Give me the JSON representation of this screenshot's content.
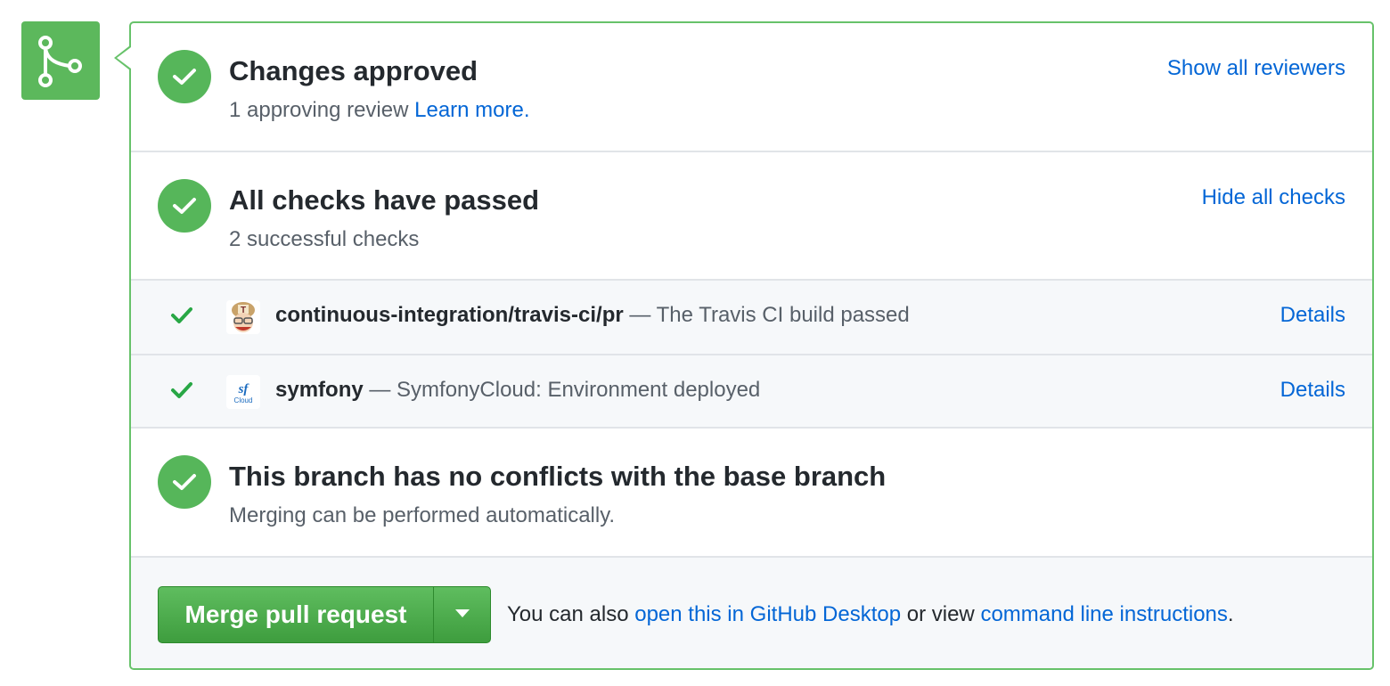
{
  "icons": {
    "merge": "git-merge-icon",
    "check": "check-icon",
    "dropdown": "triangle-down-icon"
  },
  "colors": {
    "accent": "#5cb85c",
    "link": "#0366d6",
    "border": "#67c26a"
  },
  "review": {
    "title": "Changes approved",
    "subtitle": "1 approving review",
    "learn_more": "Learn more.",
    "action": "Show all reviewers"
  },
  "checks": {
    "title": "All checks have passed",
    "subtitle": "2 successful checks",
    "action": "Hide all checks",
    "items": [
      {
        "name": "continuous-integration/travis-ci/pr",
        "description": "— The Travis CI build passed",
        "details": "Details",
        "avatar": "travis-ci-avatar"
      },
      {
        "name": "symfony",
        "description": "— SymfonyCloud: Environment deployed",
        "details": "Details",
        "avatar": "symfony-cloud-avatar"
      }
    ]
  },
  "conflicts": {
    "title": "This branch has no conflicts with the base branch",
    "subtitle": "Merging can be performed automatically."
  },
  "merge": {
    "button_label": "Merge pull request",
    "note_prefix": "You can also",
    "desktop_link": "open this in GitHub Desktop",
    "note_middle": "or view",
    "cli_link": "command line instructions",
    "note_suffix": "."
  }
}
